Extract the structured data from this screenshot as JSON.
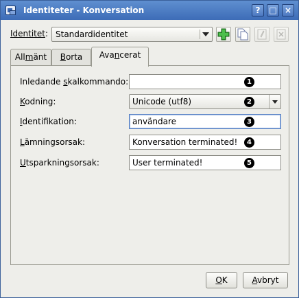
{
  "window": {
    "title": "Identiteter - Konversation",
    "buttons": {
      "help": "?",
      "maximize": "□",
      "close": "×"
    }
  },
  "identity": {
    "label_prefix": "Identitet",
    "label_suffix": ":",
    "selected": "Standardidentitet",
    "icons": [
      "add-identity-icon",
      "copy-identity-icon",
      "rename-identity-icon",
      "remove-identity-icon"
    ]
  },
  "tabs": [
    {
      "a": "All",
      "b": "m",
      "c": "änt"
    },
    {
      "a": "",
      "b": "B",
      "c": "orta"
    },
    {
      "a": "Ava",
      "b": "n",
      "c": "cerat"
    }
  ],
  "fields": {
    "shell": {
      "a": "Inledande ",
      "b": "s",
      "c": "kalkommando:",
      "value": "",
      "badge": "1"
    },
    "encoding": {
      "a": "",
      "b": "K",
      "c": "odning:",
      "value": "Unicode (utf8)",
      "badge": "2"
    },
    "ident": {
      "a": "",
      "b": "I",
      "c": "dentifikation:",
      "value": "användare",
      "badge": "3"
    },
    "part": {
      "a": "",
      "b": "L",
      "c": "ämningsorsak:",
      "value": "Konversation terminated!",
      "badge": "4"
    },
    "kick": {
      "a": "",
      "b": "U",
      "c": "tsparkningsorsak:",
      "value": "User terminated!",
      "badge": "5"
    }
  },
  "footer": {
    "ok": {
      "a": "",
      "b": "O",
      "c": "K"
    },
    "cancel": {
      "a": "",
      "b": "A",
      "c": "vbryt"
    }
  },
  "colors": {
    "titlebar": "#4a78c0",
    "background": "#eeeeea",
    "focus": "#5a83c4"
  }
}
